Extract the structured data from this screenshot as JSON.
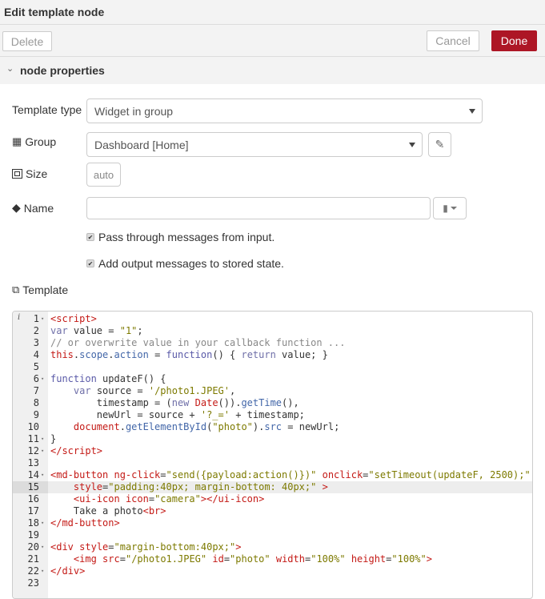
{
  "header": {
    "title": "Edit template node"
  },
  "toolbar": {
    "delete": "Delete",
    "cancel": "Cancel",
    "done": "Done",
    "done_color": "#ad1625"
  },
  "section": {
    "title": "node properties"
  },
  "form": {
    "template_type": {
      "label": "Template type",
      "value": "Widget in group"
    },
    "group": {
      "label": "Group",
      "value": "Dashboard [Home]"
    },
    "size": {
      "label": "Size",
      "value": "auto"
    },
    "name": {
      "label": "Name",
      "value": ""
    },
    "pass_through": {
      "label": "Pass through messages from input.",
      "checked": true
    },
    "add_output": {
      "label": "Add output messages to stored state.",
      "checked": true
    },
    "template": {
      "label": "Template"
    }
  },
  "editor": {
    "highlighted_line": 15,
    "fold_lines": [
      1,
      6,
      11,
      12,
      14,
      18,
      20,
      22
    ],
    "lines": [
      [
        [
          "tag",
          "<script>"
        ]
      ],
      [
        [
          "kw",
          "var"
        ],
        [
          "p",
          " value = "
        ],
        [
          "str",
          "\"1\""
        ],
        [
          "p",
          ";"
        ]
      ],
      [
        [
          "com",
          "// or overwrite value in your callback function ..."
        ]
      ],
      [
        [
          "red",
          "this"
        ],
        [
          "p",
          "."
        ],
        [
          "var",
          "scope"
        ],
        [
          "p",
          "."
        ],
        [
          "var",
          "action"
        ],
        [
          "p",
          " = "
        ],
        [
          "fn",
          "function"
        ],
        [
          "p",
          "() { "
        ],
        [
          "kw",
          "return"
        ],
        [
          "p",
          " value; }"
        ]
      ],
      [],
      [
        [
          "fn",
          "function"
        ],
        [
          "p",
          " updateF() {"
        ]
      ],
      [
        [
          "p",
          "    "
        ],
        [
          "kw",
          "var"
        ],
        [
          "p",
          " source = "
        ],
        [
          "str",
          "'/photo1.JPEG'"
        ],
        [
          "p",
          ","
        ]
      ],
      [
        [
          "p",
          "        timestamp = ("
        ],
        [
          "kw",
          "new"
        ],
        [
          "p",
          " "
        ],
        [
          "red",
          "Date"
        ],
        [
          "p",
          "())."
        ],
        [
          "var",
          "getTime"
        ],
        [
          "p",
          "(),"
        ]
      ],
      [
        [
          "p",
          "        newUrl = source + "
        ],
        [
          "str",
          "'?_='"
        ],
        [
          "p",
          " + timestamp;"
        ]
      ],
      [
        [
          "p",
          "    "
        ],
        [
          "red",
          "document"
        ],
        [
          "p",
          "."
        ],
        [
          "var",
          "getElementById"
        ],
        [
          "p",
          "("
        ],
        [
          "str",
          "\"photo\""
        ],
        [
          "p",
          ")."
        ],
        [
          "var",
          "src"
        ],
        [
          "p",
          " = newUrl;"
        ]
      ],
      [
        [
          "p",
          "}"
        ]
      ],
      [
        [
          "tag",
          "</script>"
        ]
      ],
      [],
      [
        [
          "tag",
          "<md-button"
        ],
        [
          "p",
          " "
        ],
        [
          "attr",
          "ng-click"
        ],
        [
          "p",
          "="
        ],
        [
          "str",
          "\"send({payload:action()})\""
        ],
        [
          "p",
          " "
        ],
        [
          "attr",
          "onclick"
        ],
        [
          "p",
          "="
        ],
        [
          "str",
          "\"setTimeout(updateF, 2500);\""
        ]
      ],
      [
        [
          "p",
          "    "
        ],
        [
          "attr",
          "style"
        ],
        [
          "p",
          "="
        ],
        [
          "str",
          "\"padding:40px; margin-bottom: 40px;\""
        ],
        [
          "p",
          " "
        ],
        [
          "tag",
          ">"
        ]
      ],
      [
        [
          "p",
          "    "
        ],
        [
          "tag",
          "<ui-icon"
        ],
        [
          "p",
          " "
        ],
        [
          "attr",
          "icon"
        ],
        [
          "p",
          "="
        ],
        [
          "str",
          "\"camera\""
        ],
        [
          "tag",
          "></ui-icon>"
        ]
      ],
      [
        [
          "p",
          "    Take a photo"
        ],
        [
          "tag",
          "<br>"
        ]
      ],
      [
        [
          "tag",
          "</md-button>"
        ]
      ],
      [],
      [
        [
          "tag",
          "<div"
        ],
        [
          "p",
          " "
        ],
        [
          "attr",
          "style"
        ],
        [
          "p",
          "="
        ],
        [
          "str",
          "\"margin-bottom:40px;\""
        ],
        [
          "tag",
          ">"
        ]
      ],
      [
        [
          "p",
          "    "
        ],
        [
          "tag",
          "<img"
        ],
        [
          "p",
          " "
        ],
        [
          "attr",
          "src"
        ],
        [
          "p",
          "="
        ],
        [
          "str",
          "\"/photo1.JPEG\""
        ],
        [
          "p",
          " "
        ],
        [
          "attr",
          "id"
        ],
        [
          "p",
          "="
        ],
        [
          "str",
          "\"photo\""
        ],
        [
          "p",
          " "
        ],
        [
          "attr",
          "width"
        ],
        [
          "p",
          "="
        ],
        [
          "str",
          "\"100%\""
        ],
        [
          "p",
          " "
        ],
        [
          "attr",
          "height"
        ],
        [
          "p",
          "="
        ],
        [
          "str",
          "\"100%\""
        ],
        [
          "tag",
          ">"
        ]
      ],
      [
        [
          "tag",
          "</div>"
        ]
      ],
      []
    ]
  }
}
